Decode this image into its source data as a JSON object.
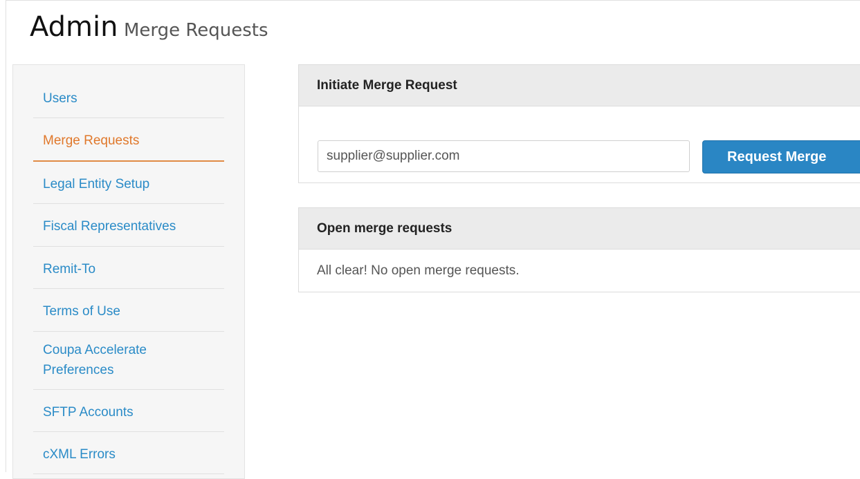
{
  "page": {
    "title": "Admin",
    "subtitle": "Merge Requests"
  },
  "sidebar": {
    "items": [
      {
        "label": "Users",
        "active": false
      },
      {
        "label": "Merge Requests",
        "active": true
      },
      {
        "label": "Legal Entity Setup",
        "active": false
      },
      {
        "label": "Fiscal Representatives",
        "active": false
      },
      {
        "label": "Remit-To",
        "active": false
      },
      {
        "label": "Terms of Use",
        "active": false
      },
      {
        "label": "Coupa Accelerate Preferences",
        "active": false
      },
      {
        "label": "SFTP Accounts",
        "active": false
      },
      {
        "label": "cXML Errors",
        "active": false
      }
    ]
  },
  "initiate": {
    "heading": "Initiate Merge Request",
    "email_value": "supplier@supplier.com",
    "button_label": "Request Merge"
  },
  "open_requests": {
    "heading": "Open merge requests",
    "empty_message": "All clear! No open merge requests."
  },
  "colors": {
    "link": "#2a8bc7",
    "active_link": "#e0782b",
    "primary_button": "#2a86c4"
  }
}
